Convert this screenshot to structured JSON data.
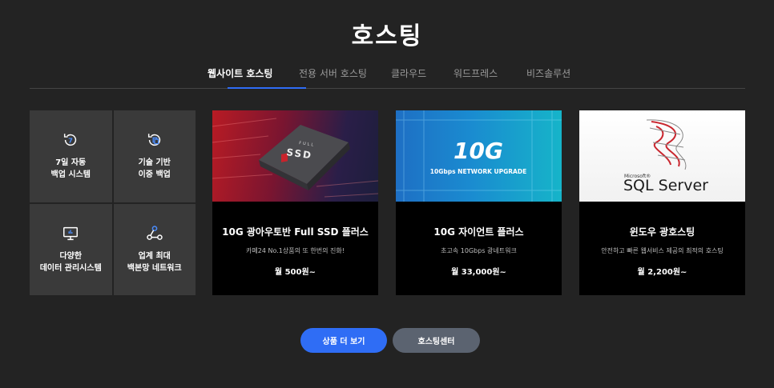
{
  "page": {
    "title": "호스팅"
  },
  "tabs": [
    {
      "label": "웹사이트 호스팅",
      "active": true
    },
    {
      "label": "전용 서버 호스팅"
    },
    {
      "label": "클라우드"
    },
    {
      "label": "워드프레스"
    },
    {
      "label": "비즈솔루션"
    }
  ],
  "features": [
    {
      "label": "7일 자동\n백업 시스템",
      "icon": "backup-7day-icon"
    },
    {
      "label": "기술 기반\n이중 백업",
      "icon": "dual-backup-icon"
    },
    {
      "label": "다양한\n데이터 관리시스템",
      "icon": "monitor-chart-icon"
    },
    {
      "label": "업계 최대\n백본망 네트워크",
      "icon": "network-nodes-icon"
    }
  ],
  "products": [
    {
      "banner_label_small": "FULL",
      "banner_label": "SSD",
      "title": "10G 광아우토반 Full SSD 플러스",
      "desc": "카페24 No.1상품의 또 한번의 진화!",
      "price": "월 500원~"
    },
    {
      "banner_label": "10G",
      "banner_sub": "10Gbps NETWORK UPGRADE",
      "title": "10G 자이언트 플러스",
      "desc": "초고속 10Gbps 광네트워크",
      "price": "월 33,000원~"
    },
    {
      "banner_label_small": "Microsoft®",
      "banner_label": "SQL Server",
      "title": "윈도우 광호스팅",
      "desc": "안전하고 빠른 웹서비스 제공의 최적의 호스팅",
      "price": "월 2,200원~"
    }
  ],
  "buttons": {
    "more": "상품 더 보기",
    "center": "호스팅센터"
  },
  "colors": {
    "background": "#232323",
    "accent": "#2f6df5",
    "secondary_button": "#5b6370",
    "feature_tile": "#3a3a3a"
  }
}
